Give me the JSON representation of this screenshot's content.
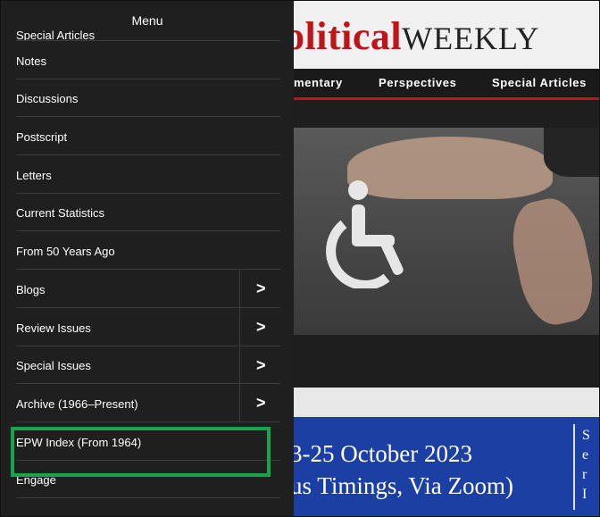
{
  "background_page": {
    "logo_part1": "Political",
    "logo_part2": "WEEKLY",
    "logo_visible_1": "olitical",
    "nav": [
      "mentary",
      "Perspectives",
      "Special Articles"
    ],
    "banner_line1": "3-25 October 2023",
    "banner_line2": "us Timings, Via Zoom)",
    "banner_side": [
      "S",
      "e",
      "r",
      "I"
    ]
  },
  "menu": {
    "title": "Menu",
    "items": [
      {
        "label": "Special Articles",
        "has_submenu": false
      },
      {
        "label": "Notes",
        "has_submenu": false
      },
      {
        "label": "Discussions",
        "has_submenu": false
      },
      {
        "label": "Postscript",
        "has_submenu": false
      },
      {
        "label": "Letters",
        "has_submenu": false
      },
      {
        "label": "Current Statistics",
        "has_submenu": false
      },
      {
        "label": "From 50 Years Ago",
        "has_submenu": false
      },
      {
        "label": "Blogs",
        "has_submenu": true
      },
      {
        "label": "Review Issues",
        "has_submenu": true
      },
      {
        "label": "Special Issues",
        "has_submenu": true
      },
      {
        "label": "Archive (1966–Present)",
        "has_submenu": true
      },
      {
        "label": "EPW Index (From 1964)",
        "has_submenu": false
      },
      {
        "label": "Engage",
        "has_submenu": false
      }
    ],
    "submenu_glyph": ">",
    "highlighted_item": "EPW Index (From 1964)",
    "highlight_color": "#19a34a"
  },
  "colors": {
    "menu_bg": "#1f1f1f",
    "brand_red": "#c0141b",
    "banner_blue": "#1b3fa3"
  },
  "icons": [
    "wheelchair-icon",
    "chevron-right-icon"
  ]
}
